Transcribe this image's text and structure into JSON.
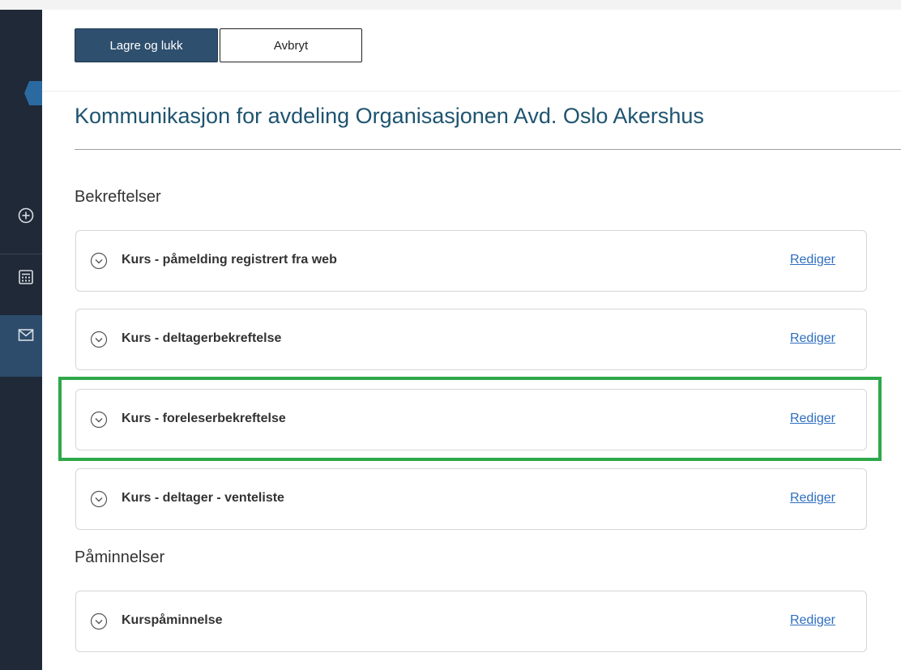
{
  "toolbar": {
    "save_label": "Lagre og lukk",
    "cancel_label": "Avbryt"
  },
  "page": {
    "title": "Kommunikasjon for avdeling Organisasjonen Avd. Oslo Akershus"
  },
  "sections": [
    {
      "heading": "Bekreftelser",
      "items": [
        {
          "label": "Kurs - påmelding registrert fra web",
          "action": "Rediger"
        },
        {
          "label": "Kurs - deltagerbekreftelse",
          "action": "Rediger"
        },
        {
          "label": "Kurs - foreleserbekreftelse",
          "action": "Rediger",
          "highlighted": true
        },
        {
          "label": "Kurs - deltager - venteliste",
          "action": "Rediger"
        }
      ]
    },
    {
      "heading": "Påminnelser",
      "items": [
        {
          "label": "Kurspåminnelse",
          "action": "Rediger"
        }
      ]
    }
  ],
  "sidebar": {
    "icons": [
      "plus-circle-icon",
      "calculator-icon",
      "mail-icon"
    ]
  },
  "colors": {
    "primary": "#2e4f6e",
    "title": "#1e5470",
    "link": "#2e6ec0",
    "highlight": "#2ea84a",
    "sidebar": "#1f2937"
  }
}
